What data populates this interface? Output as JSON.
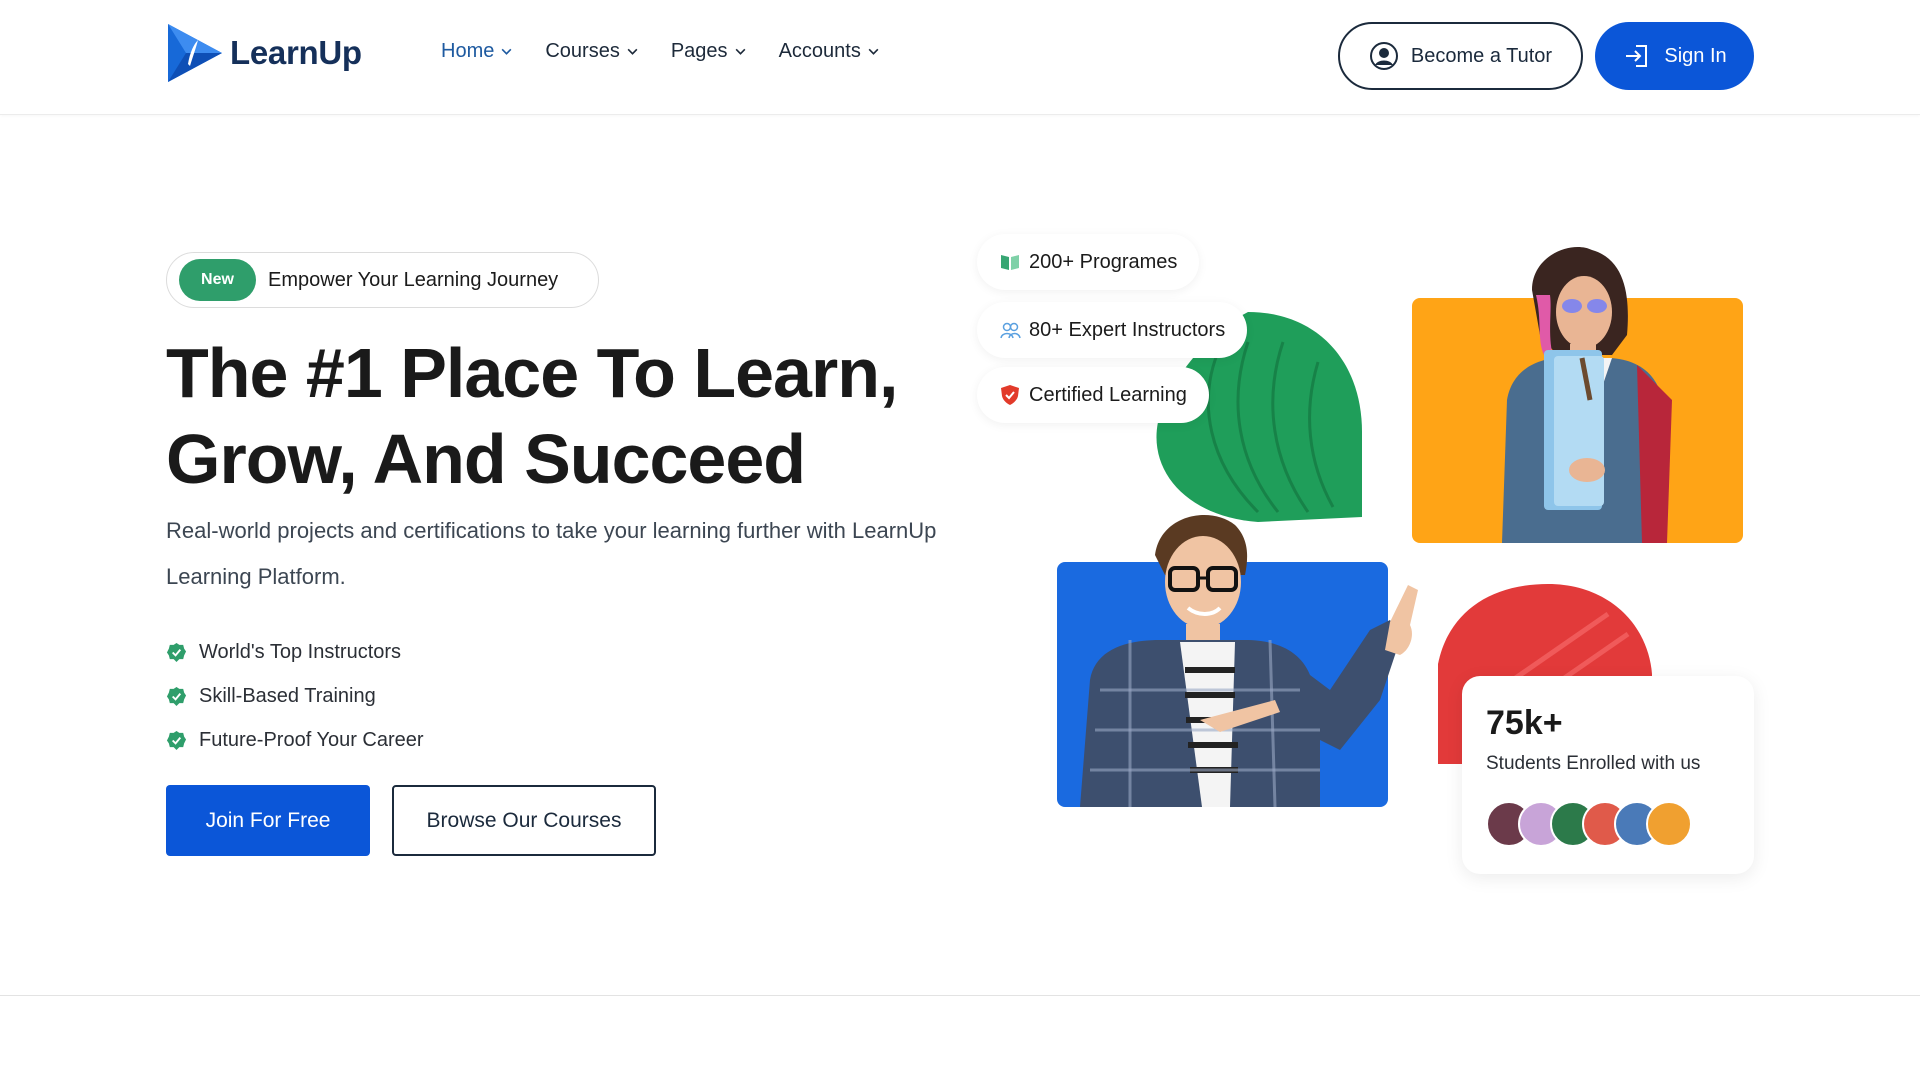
{
  "header": {
    "brand": "LearnUp",
    "nav": [
      {
        "label": "Home",
        "active": true
      },
      {
        "label": "Courses",
        "active": false
      },
      {
        "label": "Pages",
        "active": false
      },
      {
        "label": "Accounts",
        "active": false
      }
    ],
    "tutor_label": "Become a Tutor",
    "signin_label": "Sign In"
  },
  "hero": {
    "badge_new": "New",
    "badge_text": "Empower Your Learning Journey",
    "title_line1": "The #1 Place To Learn,",
    "title_line2": "Grow, And Succeed",
    "subtitle": "Real-world projects and certifications to take your learning further with LearnUp Learning Platform.",
    "features": [
      "World's Top Instructors",
      "Skill-Based Training",
      "Future-Proof Your Career"
    ],
    "join_label": "Join For Free",
    "browse_label": "Browse Our Courses"
  },
  "collage": {
    "pills": [
      "200+ Programes",
      "80+ Expert Instructors",
      "Certified Learning"
    ],
    "stats_number": "75k+",
    "stats_label": "Students Enrolled with us"
  },
  "colors": {
    "primary": "#0b56d8",
    "green": "#2f9e6b",
    "orange": "#ffa416",
    "blue_card": "#1a6ae0",
    "red_leaf": "#e23a3a",
    "green_leaf": "#1f9e5a"
  },
  "icons": {
    "logo": "play-triangle-logo",
    "tutor": "user-circle-icon",
    "signin": "login-arrow-icon",
    "programs": "book-open-icon",
    "instructors": "users-icon",
    "certified": "shield-icon"
  }
}
